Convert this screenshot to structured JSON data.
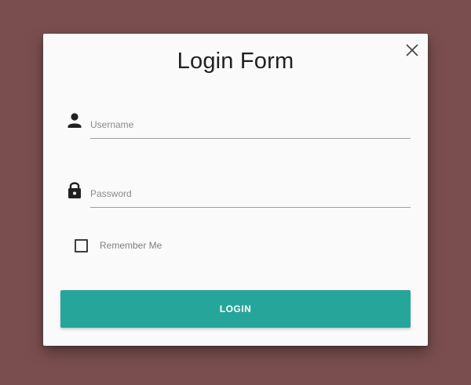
{
  "form": {
    "title": "Login Form",
    "username": {
      "placeholder": "Username",
      "value": "",
      "icon": "person-icon"
    },
    "password": {
      "placeholder": "Password",
      "value": "",
      "icon": "lock-icon"
    },
    "remember": {
      "label": "Remember Me",
      "checked": false
    },
    "submit_label": "LOGIN",
    "close_icon": "close-icon"
  },
  "colors": {
    "page_background": "#7a4e4e",
    "modal_background": "#fafafa",
    "accent": "#26a69a",
    "title_text": "#212121"
  }
}
